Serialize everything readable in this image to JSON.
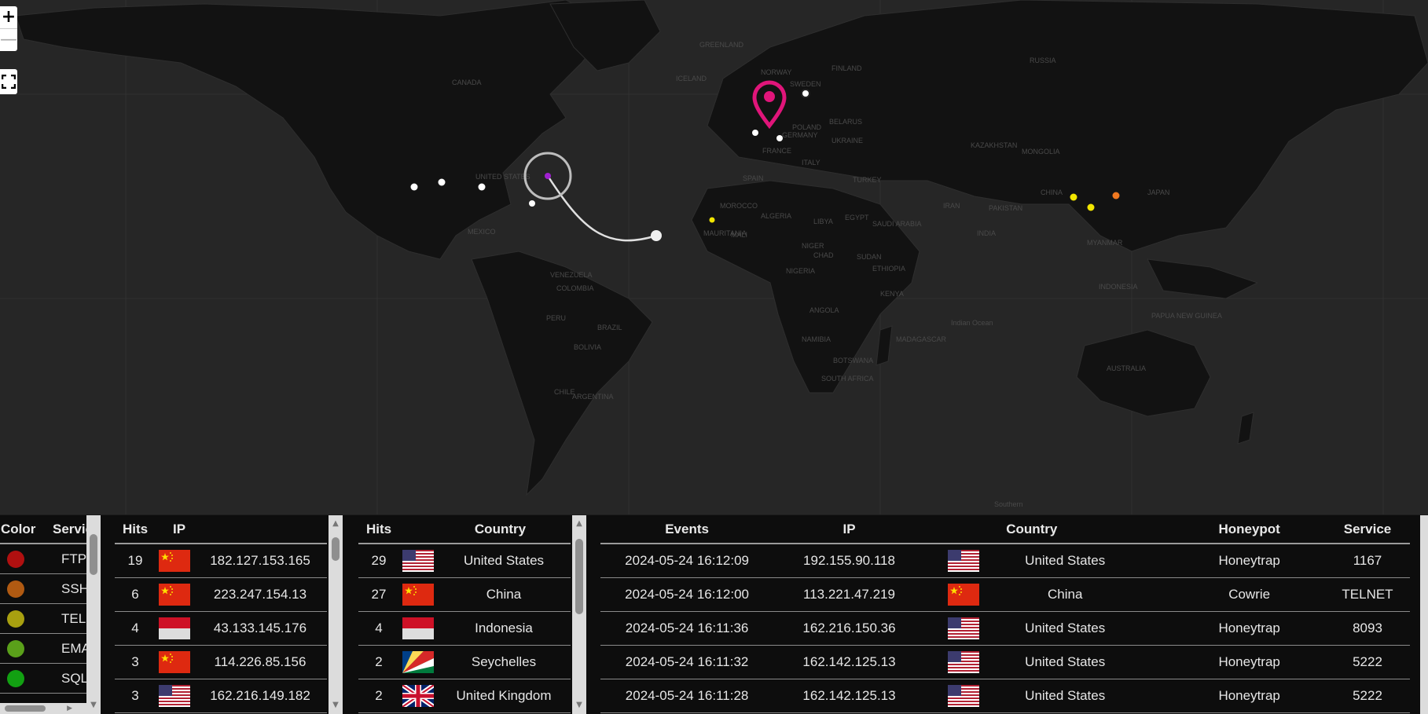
{
  "map": {
    "zoom_in_label": "+",
    "zoom_out_label": "—",
    "fullscreen_icon": "fullscreen-icon",
    "labels": [
      "RUSSIA",
      "CANADA",
      "UNITED STATES",
      "MEXICO",
      "BRAZIL",
      "PERU",
      "BOLIVIA",
      "CHILE",
      "ARGENTINA",
      "COLOMBIA",
      "VENEZUELA",
      "GREENLAND",
      "ICELAND",
      "NORWAY",
      "SWEDEN",
      "FINLAND",
      "POLAND",
      "UKRAINE",
      "BELARUS",
      "FRANCE",
      "SPAIN",
      "ITALY",
      "GERMANY",
      "TURKEY",
      "ALGERIA",
      "LIBYA",
      "EGYPT",
      "NIGER",
      "CHAD",
      "SUDAN",
      "NIGERIA",
      "ETHIOPIA",
      "KENYA",
      "ANGOLA",
      "NAMIBIA",
      "SOUTH AFRICA",
      "MADAGASCAR",
      "SAUDI ARABIA",
      "IRAN",
      "PAKISTAN",
      "INDIA",
      "KAZAKHSTAN",
      "MONGOLIA",
      "CHINA",
      "MYANMAR",
      "INDONESIA",
      "AUSTRALIA",
      "PAPUA NEW GUINEA",
      "JAPAN",
      "MALI",
      "MAURITANIA",
      "BOTSWANA",
      "MOROCCO",
      "Indian Ocean",
      "Southern"
    ],
    "marker_colors": {
      "white": "#ffffff",
      "purple": "#a020d0",
      "yellow": "#f2e600",
      "orange": "#f07820",
      "pin": "#e0157a"
    }
  },
  "service_legend": {
    "headers": {
      "color": "Color",
      "service": "Service"
    },
    "rows": [
      {
        "color": "#b01010",
        "service": "FTP"
      },
      {
        "color": "#b05a12",
        "service": "SSH"
      },
      {
        "color": "#a8a010",
        "service": "TELNET"
      },
      {
        "color": "#5aa01a",
        "service": "EMAIL"
      },
      {
        "color": "#12a012",
        "service": "SQL"
      }
    ]
  },
  "top_ips": {
    "headers": {
      "hits": "Hits",
      "ip": "IP"
    },
    "rows": [
      {
        "hits": "19",
        "flag": "cn",
        "ip": "182.127.153.165"
      },
      {
        "hits": "6",
        "flag": "cn",
        "ip": "223.247.154.13"
      },
      {
        "hits": "4",
        "flag": "id",
        "ip": "43.133.145.176"
      },
      {
        "hits": "3",
        "flag": "cn",
        "ip": "114.226.85.156"
      },
      {
        "hits": "3",
        "flag": "us",
        "ip": "162.216.149.182"
      }
    ]
  },
  "top_countries": {
    "headers": {
      "hits": "Hits",
      "country": "Country"
    },
    "rows": [
      {
        "hits": "29",
        "flag": "us",
        "country": "United States"
      },
      {
        "hits": "27",
        "flag": "cn",
        "country": "China"
      },
      {
        "hits": "4",
        "flag": "id",
        "country": "Indonesia"
      },
      {
        "hits": "2",
        "flag": "sc",
        "country": "Seychelles"
      },
      {
        "hits": "2",
        "flag": "gb",
        "country": "United Kingdom"
      }
    ]
  },
  "events": {
    "headers": {
      "events": "Events",
      "ip": "IP",
      "country": "Country",
      "honeypot": "Honeypot",
      "service": "Service"
    },
    "rows": [
      {
        "time": "2024-05-24 16:12:09",
        "ip": "192.155.90.118",
        "flag": "us",
        "country": "United States",
        "honeypot": "Honeytrap",
        "service": "1167"
      },
      {
        "time": "2024-05-24 16:12:00",
        "ip": "113.221.47.219",
        "flag": "cn",
        "country": "China",
        "honeypot": "Cowrie",
        "service": "TELNET"
      },
      {
        "time": "2024-05-24 16:11:36",
        "ip": "162.216.150.36",
        "flag": "us",
        "country": "United States",
        "honeypot": "Honeytrap",
        "service": "8093"
      },
      {
        "time": "2024-05-24 16:11:32",
        "ip": "162.142.125.13",
        "flag": "us",
        "country": "United States",
        "honeypot": "Honeytrap",
        "service": "5222"
      },
      {
        "time": "2024-05-24 16:11:28",
        "ip": "162.142.125.13",
        "flag": "us",
        "country": "United States",
        "honeypot": "Honeytrap",
        "service": "5222"
      }
    ]
  }
}
